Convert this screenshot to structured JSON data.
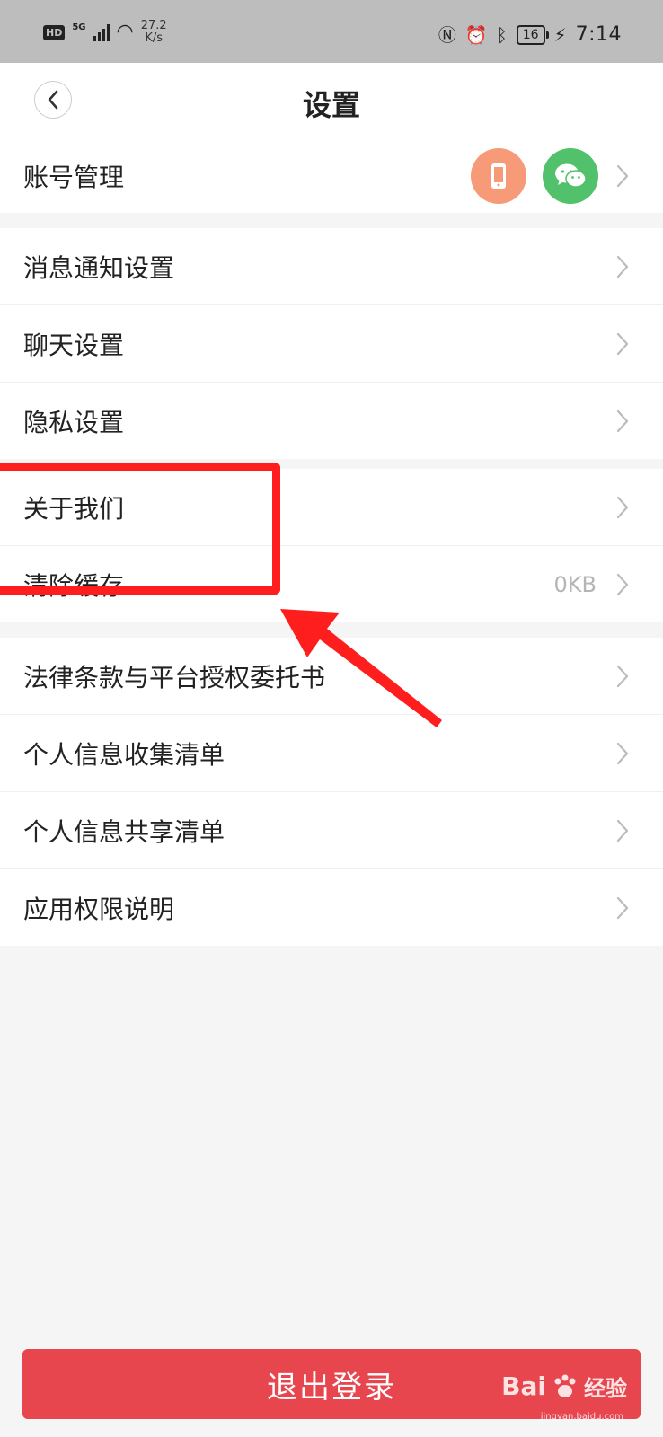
{
  "status_bar": {
    "hd": "HD",
    "network": "5G",
    "speed_value": "27.2",
    "speed_unit": "K/s",
    "battery": "16",
    "time": "7:14"
  },
  "header": {
    "title": "设置"
  },
  "account": {
    "label": "账号管理",
    "icons": [
      "phone-icon",
      "wechat-icon"
    ],
    "colors": {
      "phone": "#f79a78",
      "wechat": "#52c16b"
    }
  },
  "group1": [
    {
      "label": "消息通知设置"
    },
    {
      "label": "聊天设置"
    },
    {
      "label": "隐私设置"
    }
  ],
  "group2": [
    {
      "label": "关于我们"
    },
    {
      "label": "清除缓存",
      "value": "0KB"
    }
  ],
  "group3": [
    {
      "label": "法律条款与平台授权委托书"
    },
    {
      "label": "个人信息收集清单"
    },
    {
      "label": "个人信息共享清单"
    },
    {
      "label": "应用权限说明"
    }
  ],
  "logout": {
    "label": "退出登录",
    "color": "#e8464f"
  },
  "watermark": {
    "brand": "Bai",
    "brand2": "百度",
    "suffix": "经验",
    "url": "jingyan.baidu.com"
  },
  "annotation": {
    "color": "#ff1e1e"
  }
}
